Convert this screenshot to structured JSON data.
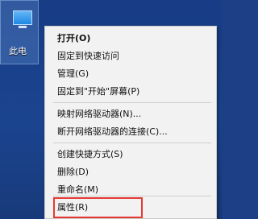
{
  "desktop": {
    "icon_label": "此电"
  },
  "menu": {
    "items": [
      {
        "label": "打开(O)"
      },
      {
        "label": "固定到快速访问"
      },
      {
        "label": "管理(G)"
      },
      {
        "label": "固定到\"开始\"屏幕(P)"
      },
      {
        "label": "映射网络驱动器(N)..."
      },
      {
        "label": "断开网络驱动器的连接(C)..."
      },
      {
        "label": "创建快捷方式(S)"
      },
      {
        "label": "删除(D)"
      },
      {
        "label": "重命名(M)"
      },
      {
        "label": "属性(R)"
      }
    ]
  }
}
